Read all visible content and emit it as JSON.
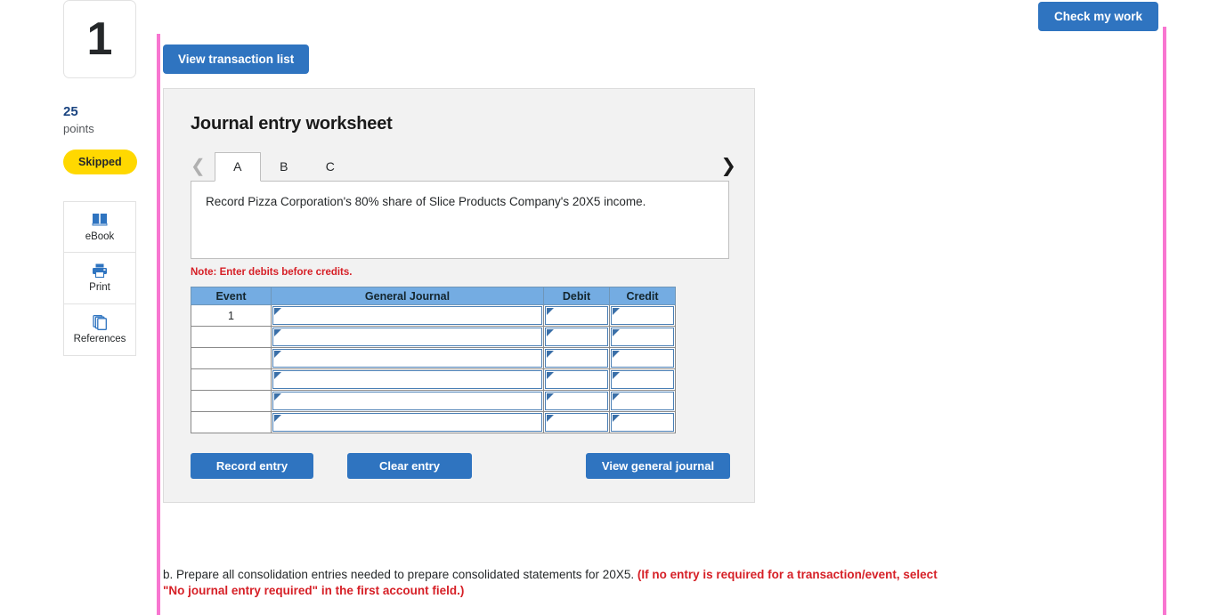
{
  "question": {
    "number": "1",
    "points_value": "25",
    "points_label": "points",
    "status_badge": "Skipped"
  },
  "tools": [
    {
      "label": "eBook",
      "icon": "ebook-icon"
    },
    {
      "label": "Print",
      "icon": "printer-icon"
    },
    {
      "label": "References",
      "icon": "references-icon"
    }
  ],
  "header": {
    "check_my_work": "Check my work"
  },
  "toolbar": {
    "view_transaction_list": "View transaction list"
  },
  "worksheet": {
    "title": "Journal entry worksheet",
    "prev_icon": "chevron-left-icon",
    "next_icon": "chevron-right-icon",
    "tabs": [
      {
        "label": "A",
        "active": true
      },
      {
        "label": "B",
        "active": false
      },
      {
        "label": "C",
        "active": false
      }
    ],
    "description": "Record Pizza Corporation's 80% share of Slice Products Company's 20X5 income.",
    "note": "Note: Enter debits before credits."
  },
  "journal": {
    "columns": [
      "Event",
      "General Journal",
      "Debit",
      "Credit"
    ],
    "rows": [
      {
        "event": "1",
        "general_journal": "",
        "debit": "",
        "credit": ""
      },
      {
        "event": "",
        "general_journal": "",
        "debit": "",
        "credit": ""
      },
      {
        "event": "",
        "general_journal": "",
        "debit": "",
        "credit": ""
      },
      {
        "event": "",
        "general_journal": "",
        "debit": "",
        "credit": ""
      },
      {
        "event": "",
        "general_journal": "",
        "debit": "",
        "credit": ""
      },
      {
        "event": "",
        "general_journal": "",
        "debit": "",
        "credit": ""
      }
    ]
  },
  "actions": {
    "record_entry": "Record entry",
    "clear_entry": "Clear entry",
    "view_general_journal": "View general journal"
  },
  "prompt": {
    "plain": "b. Prepare all consolidation entries needed to prepare consolidated statements for 20X5. ",
    "emphasis": "(If no entry is required for a transaction/event, select \"No journal entry required\" in the first account field.)"
  },
  "colors": {
    "accent_blue": "#2f74c0",
    "table_header_blue": "#74ace2",
    "badge_yellow": "#ffd800",
    "alert_red": "#d61f26",
    "boundary_pink": "#f876d0",
    "points_navy": "#1a4480"
  }
}
